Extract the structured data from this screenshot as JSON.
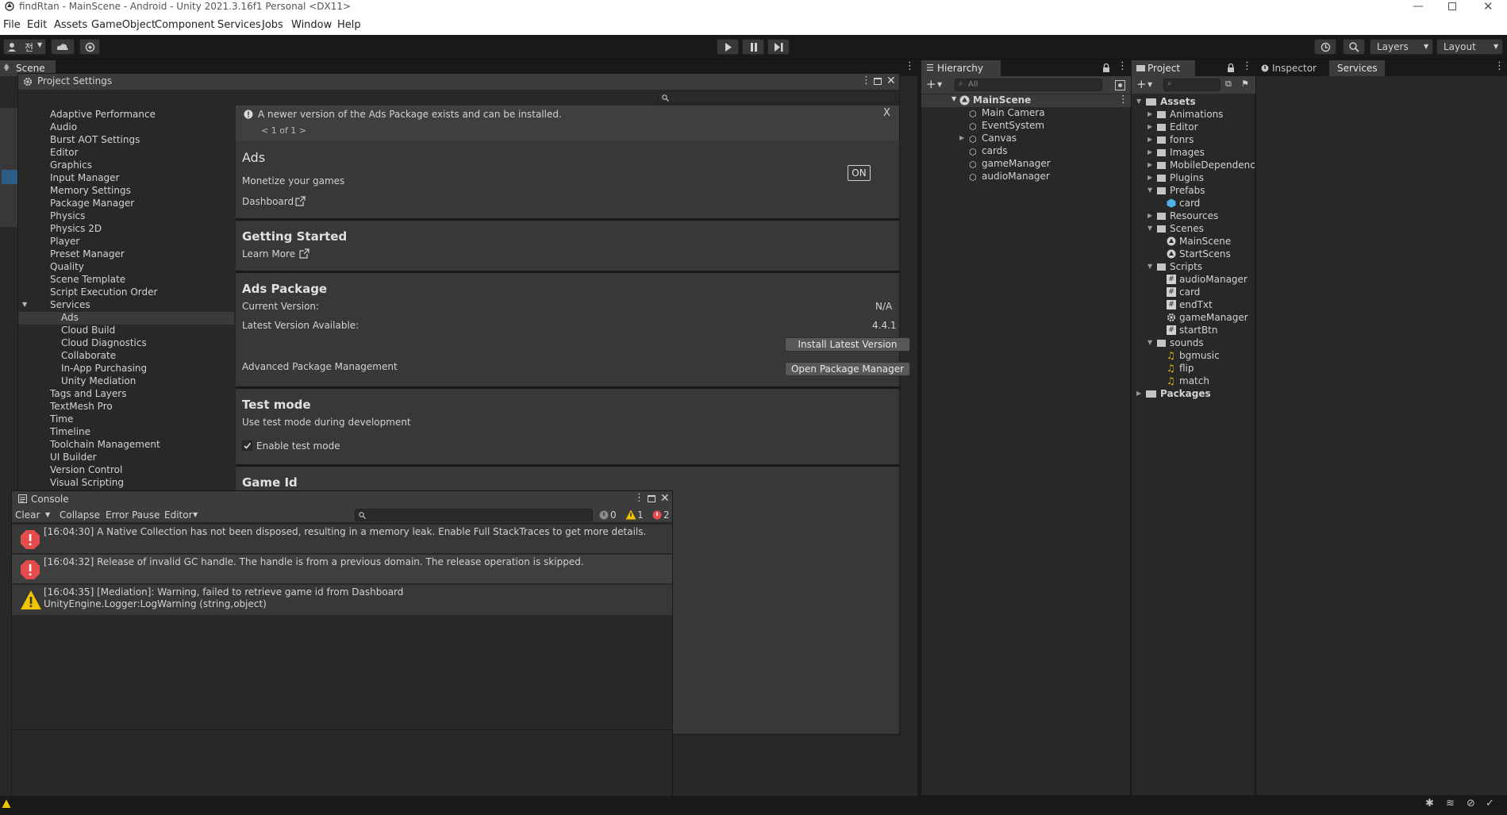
{
  "window": {
    "title": "findRtan - MainScene - Android - Unity 2021.3.16f1 Personal <DX11>"
  },
  "menu": [
    "File",
    "Edit",
    "Assets",
    "GameObject",
    "Component",
    "Services",
    "Jobs",
    "Window",
    "Help"
  ],
  "toolbar": {
    "account_label": "전",
    "layers_label": "Layers",
    "layout_label": "Layout"
  },
  "scene_tab": {
    "label": "Scene"
  },
  "project_settings": {
    "tab_label": "Project Settings",
    "sidebar": [
      "Adaptive Performance",
      "Audio",
      "Burst AOT Settings",
      "Editor",
      "Graphics",
      "Input Manager",
      "Memory Settings",
      "Package Manager",
      "Physics",
      "Physics 2D",
      "Player",
      "Preset Manager",
      "Quality",
      "Scene Template",
      "Script Execution Order",
      "Services",
      "Ads",
      "Cloud Build",
      "Cloud Diagnostics",
      "Collaborate",
      "In-App Purchasing",
      "Unity Mediation",
      "Tags and Layers",
      "TextMesh Pro",
      "Time",
      "Timeline",
      "Toolchain Management",
      "UI Builder",
      "Version Control",
      "Visual Scripting"
    ],
    "notice": {
      "text": "A newer version of the Ads Package exists and can be installed.",
      "pager": "< 1 of 1 >",
      "close": "X"
    },
    "ads": {
      "title": "Ads",
      "subtitle": "Monetize your games",
      "toggle": "ON",
      "dashboard_link": "Dashboard"
    },
    "getting_started": {
      "title": "Getting Started",
      "learn_more": "Learn More"
    },
    "ads_package": {
      "title": "Ads Package",
      "current_label": "Current Version:",
      "current_value": "N/A",
      "latest_label": "Latest Version Available:",
      "latest_value": "4.4.1",
      "install_button": "Install Latest Version",
      "advanced_label": "Advanced Package Management",
      "open_pm_button": "Open Package Manager"
    },
    "test_mode": {
      "title": "Test mode",
      "subtitle": "Use test mode during development",
      "checkbox_label": "Enable test mode",
      "checked": true
    },
    "game_id": {
      "title": "Game Id"
    }
  },
  "hierarchy": {
    "tab_label": "Hierarchy",
    "search_placeholder": "All",
    "scene": "MainScene",
    "items": [
      "Main Camera",
      "EventSystem",
      "Canvas",
      "cards",
      "gameManager",
      "audioManager"
    ]
  },
  "project": {
    "tab_label": "Project",
    "root": "Assets",
    "folders": [
      "Animations",
      "Editor",
      "fonrs",
      "Images",
      "MobileDependency",
      "Plugins",
      "Prefabs",
      "card",
      "Resources",
      "Scenes",
      "MainScene",
      "StartScens",
      "Scripts",
      "audioManager",
      "card",
      "endTxt",
      "gameManager",
      "startBtn",
      "sounds",
      "bgmusic",
      "flip",
      "match",
      "Packages"
    ]
  },
  "inspector": {
    "tabs": [
      "Inspector",
      "Services"
    ]
  },
  "console": {
    "tab_label": "Console",
    "toolbar": {
      "clear": "Clear",
      "collapse": "Collapse",
      "error_pause": "Error Pause",
      "editor": "Editor"
    },
    "counts": {
      "info": "0",
      "warning": "1",
      "error": "2"
    },
    "entries": [
      {
        "type": "error",
        "line1": "[16:04:30] A Native Collection has not been disposed, resulting in a memory leak. Enable Full StackTraces to get more details.",
        "line2": ""
      },
      {
        "type": "error",
        "line1": "[16:04:32] Release of invalid GC handle. The handle is from a previous domain. The release operation is skipped.",
        "line2": ""
      },
      {
        "type": "warning",
        "line1": "[16:04:35] [Mediation]: Warning, failed to retrieve game id from Dashboard",
        "line2": "UnityEngine.Logger:LogWarning (string,object)"
      }
    ]
  },
  "colors": {
    "error": "#e74c4c",
    "warning": "#f0c400",
    "selection": "#2c5d87",
    "panel": "#383838"
  }
}
